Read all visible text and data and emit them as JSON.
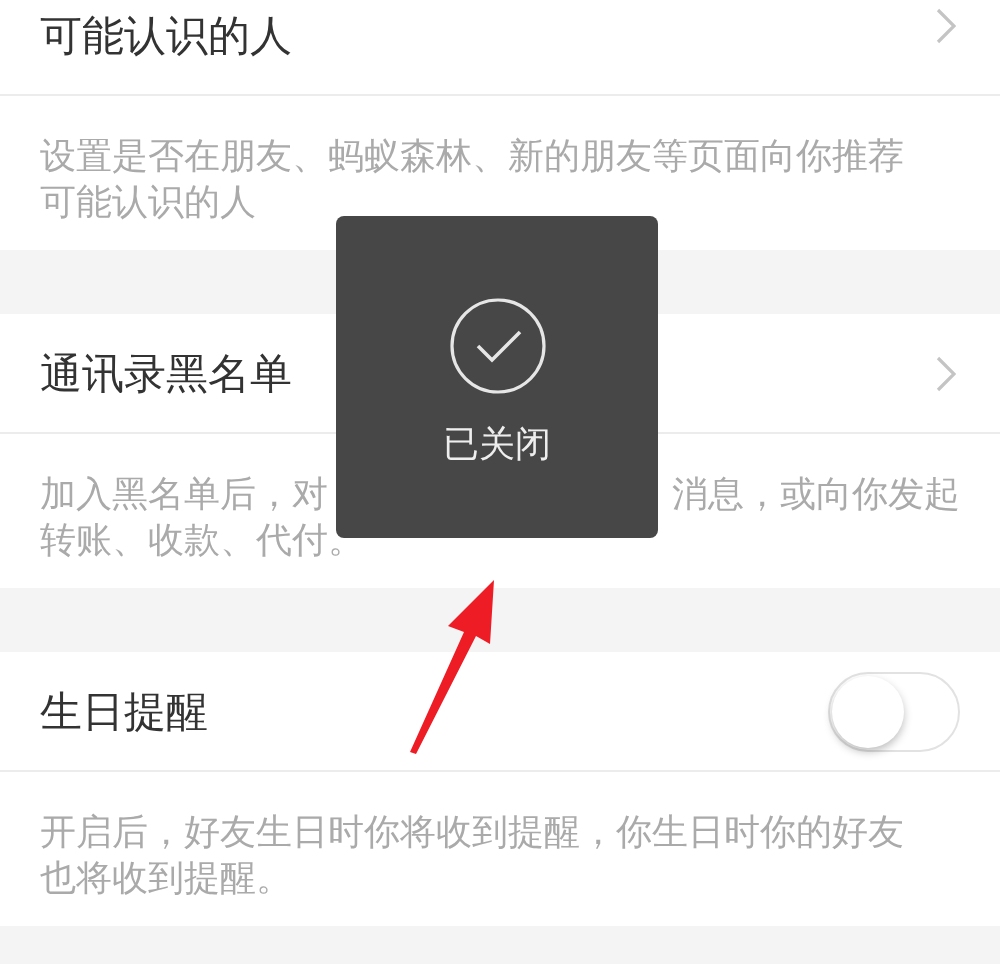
{
  "sections": [
    {
      "title": "可能认识的人",
      "control": {
        "kind": "chevron"
      },
      "description_lines": [
        [
          "设置是否在朋友、蚂蚁森林、新的朋友等页面向你推荐"
        ],
        [
          "可能认识的人"
        ]
      ]
    },
    {
      "title": "通讯录黑名单",
      "control": {
        "kind": "chevron"
      },
      "description_lines": [
        [
          "加入黑名单后，对",
          "消息，或向你发起"
        ],
        [
          "转账、收款、代付。"
        ]
      ]
    },
    {
      "title": "生日提醒",
      "control": {
        "kind": "toggle",
        "on": false
      },
      "description_lines": [
        [
          "开启后，好友生日时你将收到提醒，你生日时你的好友"
        ],
        [
          "也将收到提醒。"
        ]
      ]
    }
  ],
  "toast": {
    "text": "已关闭"
  }
}
